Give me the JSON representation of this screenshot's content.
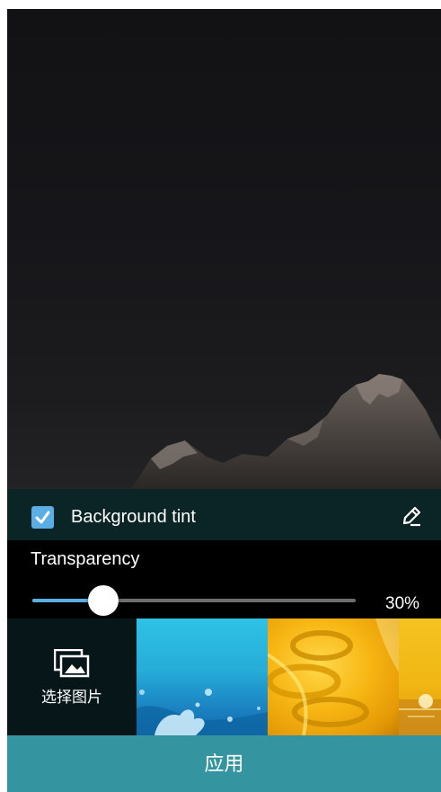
{
  "settings": {
    "tint_label": "Background tint",
    "tint_checked": true,
    "transparency_label": "Transparency",
    "transparency_value": "30%",
    "transparency_fraction": 0.22
  },
  "thumbnails": {
    "pick_label": "选择图片",
    "pick_icon": "gallery-icon",
    "items": [
      "wallpaper-water",
      "wallpaper-rope",
      "wallpaper-sunset"
    ]
  },
  "actions": {
    "apply_label": "应用"
  },
  "colors": {
    "accent": "#5aaee3",
    "apply_bar": "#34949f",
    "tint_row": "#0b2527"
  }
}
